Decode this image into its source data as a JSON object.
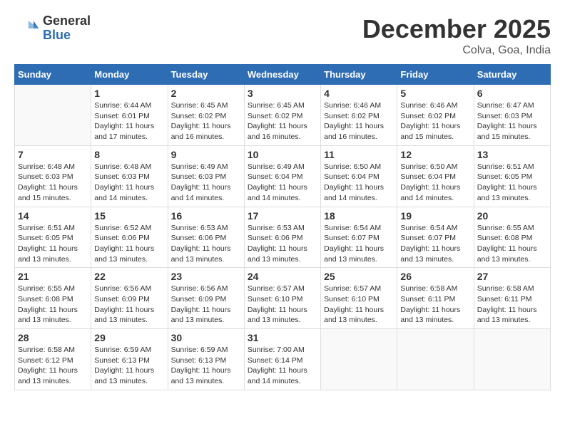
{
  "header": {
    "logo": {
      "general": "General",
      "blue": "Blue"
    },
    "title": "December 2025",
    "location": "Colva, Goa, India"
  },
  "days_of_week": [
    "Sunday",
    "Monday",
    "Tuesday",
    "Wednesday",
    "Thursday",
    "Friday",
    "Saturday"
  ],
  "weeks": [
    [
      {
        "num": "",
        "sunrise": "",
        "sunset": "",
        "daylight": ""
      },
      {
        "num": "1",
        "sunrise": "Sunrise: 6:44 AM",
        "sunset": "Sunset: 6:01 PM",
        "daylight": "Daylight: 11 hours and 17 minutes."
      },
      {
        "num": "2",
        "sunrise": "Sunrise: 6:45 AM",
        "sunset": "Sunset: 6:02 PM",
        "daylight": "Daylight: 11 hours and 16 minutes."
      },
      {
        "num": "3",
        "sunrise": "Sunrise: 6:45 AM",
        "sunset": "Sunset: 6:02 PM",
        "daylight": "Daylight: 11 hours and 16 minutes."
      },
      {
        "num": "4",
        "sunrise": "Sunrise: 6:46 AM",
        "sunset": "Sunset: 6:02 PM",
        "daylight": "Daylight: 11 hours and 16 minutes."
      },
      {
        "num": "5",
        "sunrise": "Sunrise: 6:46 AM",
        "sunset": "Sunset: 6:02 PM",
        "daylight": "Daylight: 11 hours and 15 minutes."
      },
      {
        "num": "6",
        "sunrise": "Sunrise: 6:47 AM",
        "sunset": "Sunset: 6:03 PM",
        "daylight": "Daylight: 11 hours and 15 minutes."
      }
    ],
    [
      {
        "num": "7",
        "sunrise": "Sunrise: 6:48 AM",
        "sunset": "Sunset: 6:03 PM",
        "daylight": "Daylight: 11 hours and 15 minutes."
      },
      {
        "num": "8",
        "sunrise": "Sunrise: 6:48 AM",
        "sunset": "Sunset: 6:03 PM",
        "daylight": "Daylight: 11 hours and 14 minutes."
      },
      {
        "num": "9",
        "sunrise": "Sunrise: 6:49 AM",
        "sunset": "Sunset: 6:03 PM",
        "daylight": "Daylight: 11 hours and 14 minutes."
      },
      {
        "num": "10",
        "sunrise": "Sunrise: 6:49 AM",
        "sunset": "Sunset: 6:04 PM",
        "daylight": "Daylight: 11 hours and 14 minutes."
      },
      {
        "num": "11",
        "sunrise": "Sunrise: 6:50 AM",
        "sunset": "Sunset: 6:04 PM",
        "daylight": "Daylight: 11 hours and 14 minutes."
      },
      {
        "num": "12",
        "sunrise": "Sunrise: 6:50 AM",
        "sunset": "Sunset: 6:04 PM",
        "daylight": "Daylight: 11 hours and 14 minutes."
      },
      {
        "num": "13",
        "sunrise": "Sunrise: 6:51 AM",
        "sunset": "Sunset: 6:05 PM",
        "daylight": "Daylight: 11 hours and 13 minutes."
      }
    ],
    [
      {
        "num": "14",
        "sunrise": "Sunrise: 6:51 AM",
        "sunset": "Sunset: 6:05 PM",
        "daylight": "Daylight: 11 hours and 13 minutes."
      },
      {
        "num": "15",
        "sunrise": "Sunrise: 6:52 AM",
        "sunset": "Sunset: 6:06 PM",
        "daylight": "Daylight: 11 hours and 13 minutes."
      },
      {
        "num": "16",
        "sunrise": "Sunrise: 6:53 AM",
        "sunset": "Sunset: 6:06 PM",
        "daylight": "Daylight: 11 hours and 13 minutes."
      },
      {
        "num": "17",
        "sunrise": "Sunrise: 6:53 AM",
        "sunset": "Sunset: 6:06 PM",
        "daylight": "Daylight: 11 hours and 13 minutes."
      },
      {
        "num": "18",
        "sunrise": "Sunrise: 6:54 AM",
        "sunset": "Sunset: 6:07 PM",
        "daylight": "Daylight: 11 hours and 13 minutes."
      },
      {
        "num": "19",
        "sunrise": "Sunrise: 6:54 AM",
        "sunset": "Sunset: 6:07 PM",
        "daylight": "Daylight: 11 hours and 13 minutes."
      },
      {
        "num": "20",
        "sunrise": "Sunrise: 6:55 AM",
        "sunset": "Sunset: 6:08 PM",
        "daylight": "Daylight: 11 hours and 13 minutes."
      }
    ],
    [
      {
        "num": "21",
        "sunrise": "Sunrise: 6:55 AM",
        "sunset": "Sunset: 6:08 PM",
        "daylight": "Daylight: 11 hours and 13 minutes."
      },
      {
        "num": "22",
        "sunrise": "Sunrise: 6:56 AM",
        "sunset": "Sunset: 6:09 PM",
        "daylight": "Daylight: 11 hours and 13 minutes."
      },
      {
        "num": "23",
        "sunrise": "Sunrise: 6:56 AM",
        "sunset": "Sunset: 6:09 PM",
        "daylight": "Daylight: 11 hours and 13 minutes."
      },
      {
        "num": "24",
        "sunrise": "Sunrise: 6:57 AM",
        "sunset": "Sunset: 6:10 PM",
        "daylight": "Daylight: 11 hours and 13 minutes."
      },
      {
        "num": "25",
        "sunrise": "Sunrise: 6:57 AM",
        "sunset": "Sunset: 6:10 PM",
        "daylight": "Daylight: 11 hours and 13 minutes."
      },
      {
        "num": "26",
        "sunrise": "Sunrise: 6:58 AM",
        "sunset": "Sunset: 6:11 PM",
        "daylight": "Daylight: 11 hours and 13 minutes."
      },
      {
        "num": "27",
        "sunrise": "Sunrise: 6:58 AM",
        "sunset": "Sunset: 6:11 PM",
        "daylight": "Daylight: 11 hours and 13 minutes."
      }
    ],
    [
      {
        "num": "28",
        "sunrise": "Sunrise: 6:58 AM",
        "sunset": "Sunset: 6:12 PM",
        "daylight": "Daylight: 11 hours and 13 minutes."
      },
      {
        "num": "29",
        "sunrise": "Sunrise: 6:59 AM",
        "sunset": "Sunset: 6:13 PM",
        "daylight": "Daylight: 11 hours and 13 minutes."
      },
      {
        "num": "30",
        "sunrise": "Sunrise: 6:59 AM",
        "sunset": "Sunset: 6:13 PM",
        "daylight": "Daylight: 11 hours and 13 minutes."
      },
      {
        "num": "31",
        "sunrise": "Sunrise: 7:00 AM",
        "sunset": "Sunset: 6:14 PM",
        "daylight": "Daylight: 11 hours and 14 minutes."
      },
      {
        "num": "",
        "sunrise": "",
        "sunset": "",
        "daylight": ""
      },
      {
        "num": "",
        "sunrise": "",
        "sunset": "",
        "daylight": ""
      },
      {
        "num": "",
        "sunrise": "",
        "sunset": "",
        "daylight": ""
      }
    ]
  ]
}
